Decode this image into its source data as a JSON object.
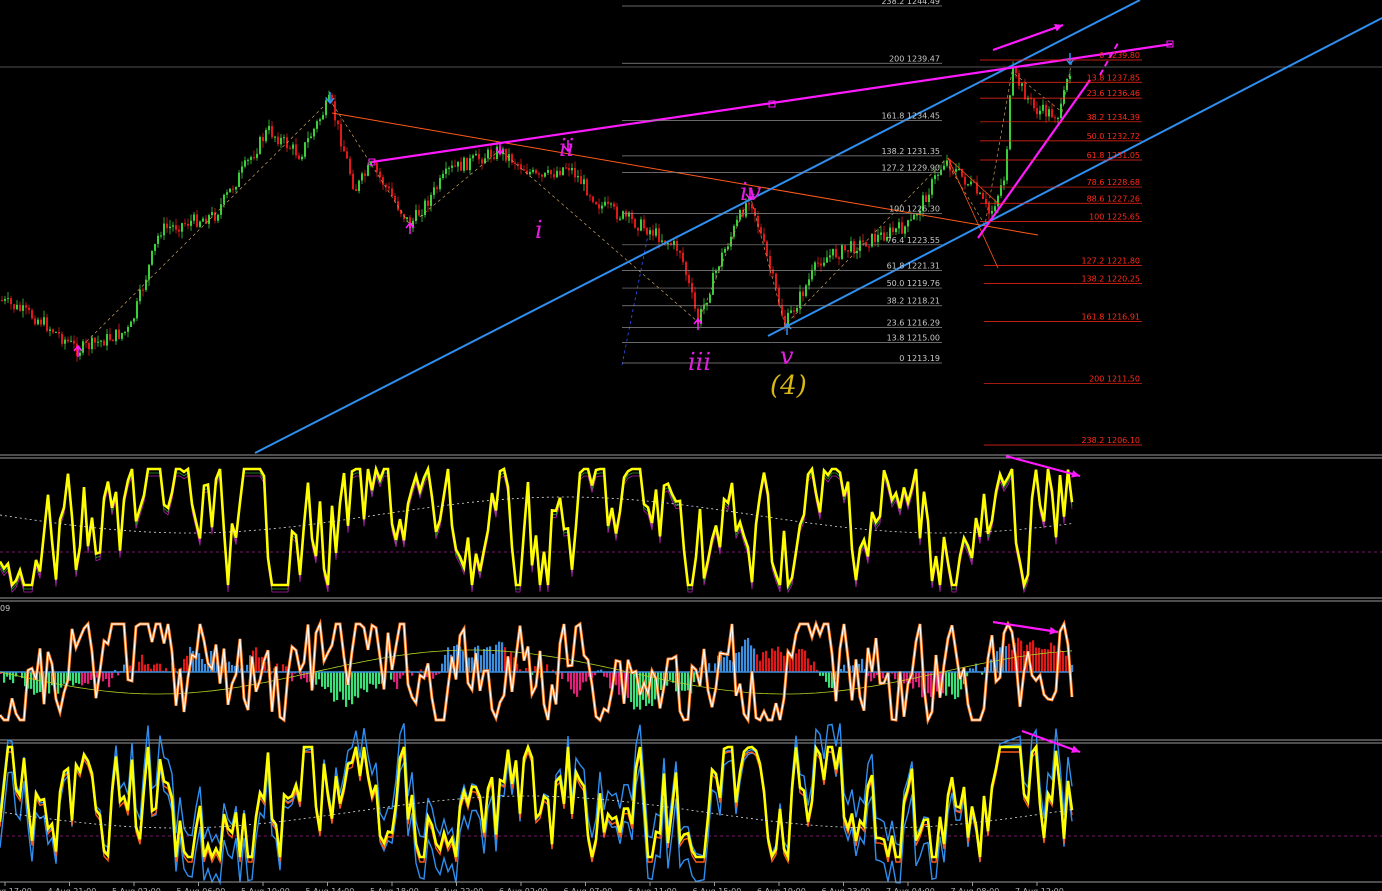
{
  "chart_data": {
    "type": "line",
    "instrument_scale": "price",
    "fib_left": [
      {
        "ratio": "238.2",
        "price": 1244.49
      },
      {
        "ratio": "200",
        "price": 1239.47
      },
      {
        "ratio": "161.8",
        "price": 1234.45
      },
      {
        "ratio": "138.2",
        "price": 1231.35
      },
      {
        "ratio": "127.2",
        "price": 1229.9
      },
      {
        "ratio": "100",
        "price": 1226.3
      },
      {
        "ratio": "76.4",
        "price": 1223.55
      },
      {
        "ratio": "61.8",
        "price": 1221.31
      },
      {
        "ratio": "50.0",
        "price": 1219.76
      },
      {
        "ratio": "38.2",
        "price": 1218.21
      },
      {
        "ratio": "23.6",
        "price": 1216.29
      },
      {
        "ratio": "13.8",
        "price": 1215.0
      },
      {
        "ratio": "0",
        "price": 1213.19
      }
    ],
    "fib_right": [
      {
        "ratio": "0",
        "price": 1239.8
      },
      {
        "ratio": "13.8",
        "price": 1237.85
      },
      {
        "ratio": "23.6",
        "price": 1236.46
      },
      {
        "ratio": "38.2",
        "price": 1234.39
      },
      {
        "ratio": "50.0",
        "price": 1232.72
      },
      {
        "ratio": "61.8",
        "price": 1231.05
      },
      {
        "ratio": "78.6",
        "price": 1228.68
      },
      {
        "ratio": "88.6",
        "price": 1227.26
      },
      {
        "ratio": "100",
        "price": 1225.65
      },
      {
        "ratio": "127.2",
        "price": 1221.8
      },
      {
        "ratio": "138.2",
        "price": 1220.25
      },
      {
        "ratio": "161.8",
        "price": 1216.91
      },
      {
        "ratio": "200",
        "price": 1211.5
      },
      {
        "ratio": "238.2",
        "price": 1206.1
      }
    ],
    "wave_labels": [
      "i",
      "ii",
      "iii",
      "iv",
      "v",
      "(4)"
    ],
    "x_ticks": [
      "4 Aug 17:00",
      "4 Aug 21:00",
      "5 Aug 02:00",
      "5 Aug 06:00",
      "5 Aug 10:00",
      "5 Aug 14:00",
      "5 Aug 18:00",
      "5 Aug 22:00",
      "6 Aug 02:00",
      "6 Aug 07:00",
      "6 Aug 11:00",
      "6 Aug 15:00",
      "6 Aug 19:00",
      "6 Aug 23:00",
      "7 Aug 04:00",
      "7 Aug 08:00",
      "7 Aug 12:00"
    ],
    "panel3_label": "09",
    "grid": false
  },
  "colors": {
    "background": "#000000",
    "bull": "#3ad03a",
    "bear": "#e01818",
    "magenta": "#ff1aff",
    "channel": "#2f8ff0",
    "fib_left": "#8c8c8c",
    "fib_right": "#ff2a1a",
    "oscillator": "#ffff00",
    "wave4": "#d8b814",
    "hist_up": "#e01818",
    "hist_blue": "#3a8fe0",
    "hist_green": "#3ae07a",
    "hist_pink": "#e0207a"
  }
}
